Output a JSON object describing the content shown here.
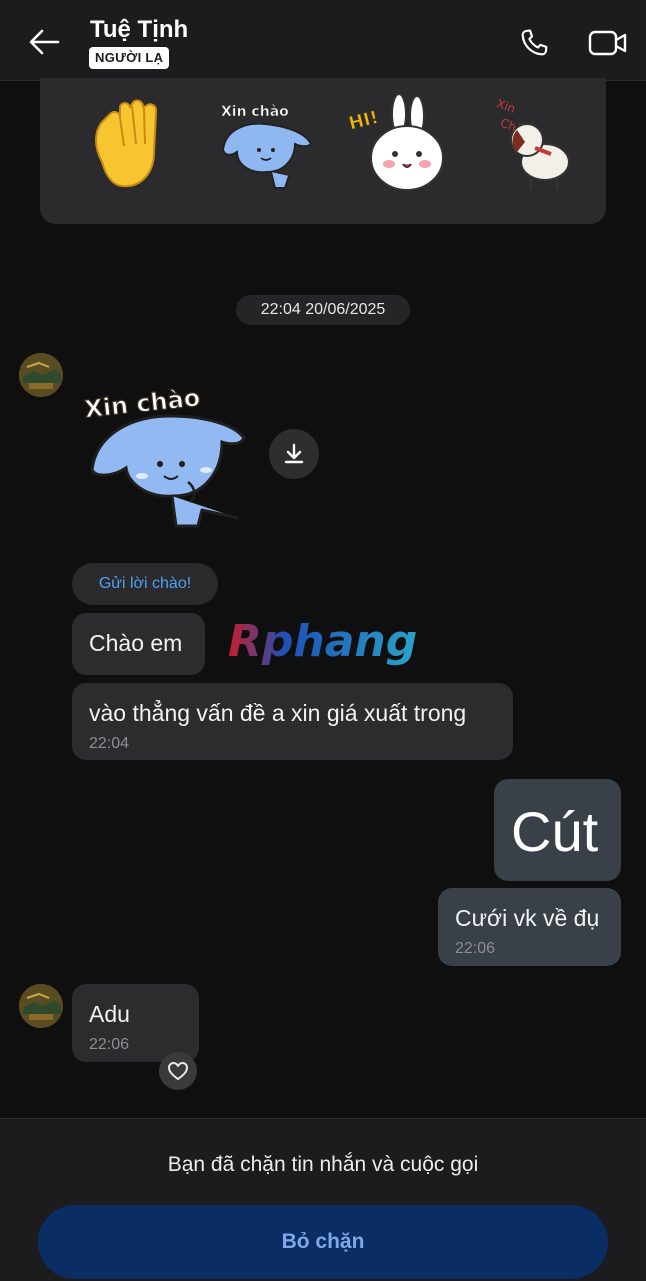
{
  "header": {
    "contact_name": "Tuệ Tịnh",
    "badge": "NGƯỜI LẠ",
    "icons": {
      "back": "arrow-left-icon",
      "call": "phone-icon",
      "video": "video-camera-icon"
    }
  },
  "sticker_tray": {
    "stickers": [
      {
        "name": "waving-hand-sticker"
      },
      {
        "name": "blue-cat-xin-chao-sticker",
        "text": "Xin chào"
      },
      {
        "name": "bunny-hi-sticker",
        "text": "HI!"
      },
      {
        "name": "dog-xin-chao-sticker",
        "text": "Xin Chào"
      }
    ]
  },
  "conversation": {
    "date_separator": "22:04 20/06/2025",
    "incoming_sticker": {
      "text": "Xin chào"
    },
    "greeting_chip": "Gửi lời chào!",
    "messages": [
      {
        "direction": "in",
        "text": "Chào em",
        "time": ""
      },
      {
        "direction": "in",
        "text": "vào thẳng vấn đề a xin giá xuất trong",
        "time": "22:04"
      },
      {
        "direction": "out",
        "text": "Cút",
        "time": ""
      },
      {
        "direction": "out",
        "text": "Cưới vk về đụ",
        "time": "22:06"
      },
      {
        "direction": "in",
        "text": "Adu",
        "time": "22:06"
      }
    ]
  },
  "watermark": "Rphang",
  "bottom": {
    "blocked_notice": "Bạn đã chặn tin nhắn và cuộc gọi",
    "unblock_label": "Bỏ chặn"
  },
  "colors": {
    "background": "#0f0f10",
    "header": "#1c1c1e",
    "incoming_bubble": "#2c2c2e",
    "outgoing_bubble": "#3a4048",
    "greeting_chip_text": "#4ea1f3",
    "unblock_button": "#0a2d63",
    "unblock_text": "#7fa7e6"
  }
}
